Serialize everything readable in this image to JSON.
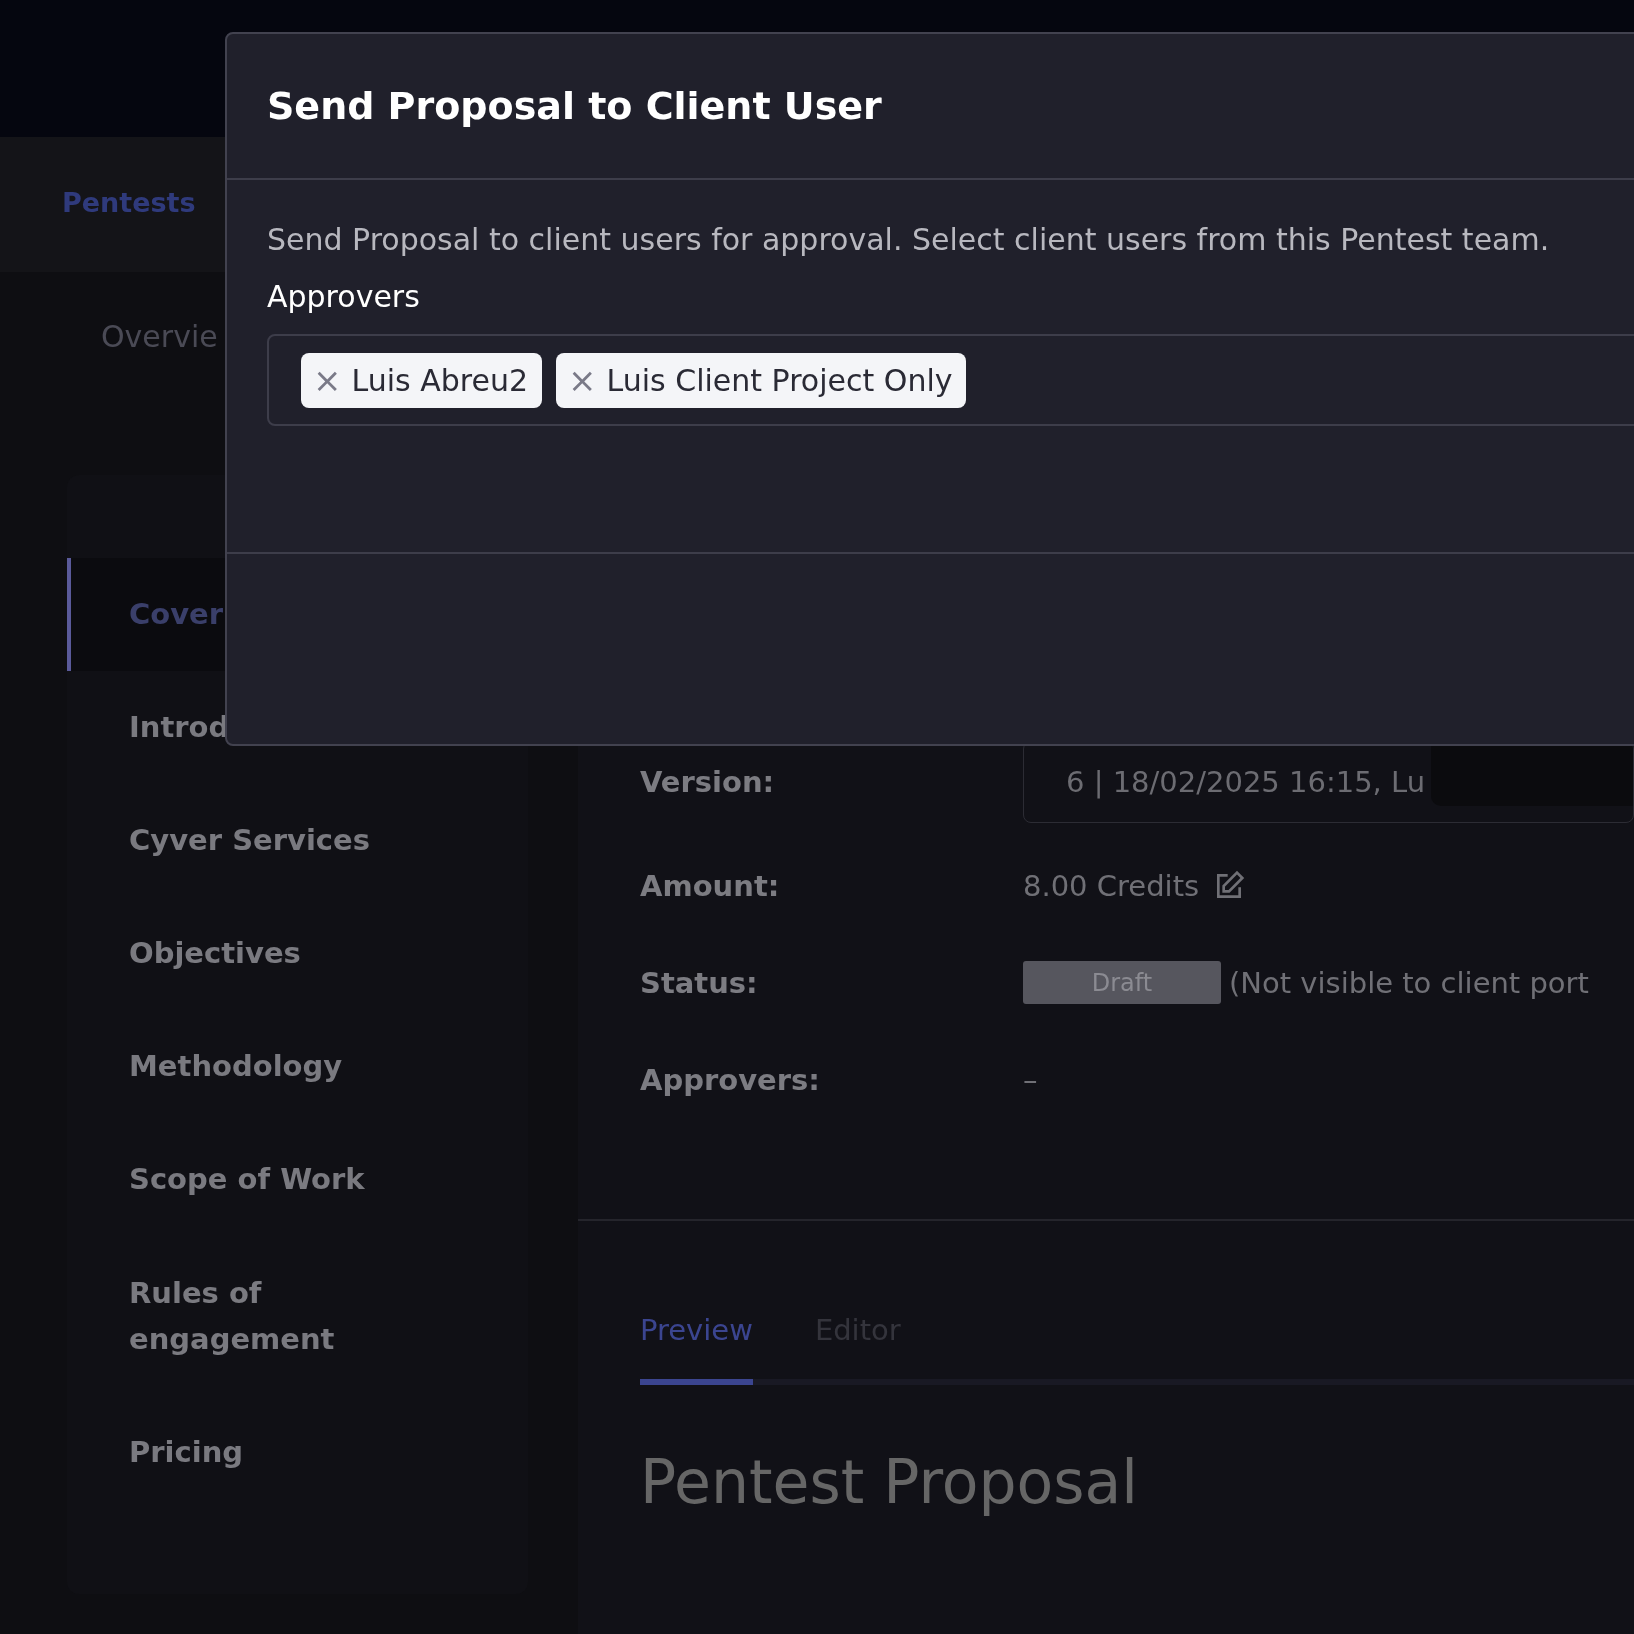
{
  "header": {
    "title": "Pentests"
  },
  "overview_tab": {
    "label": "Overvie"
  },
  "sidebar": {
    "items": [
      {
        "label": "Cover",
        "selected": true
      },
      {
        "label": "Introd",
        "selected": false
      },
      {
        "label": "Cyver Services",
        "selected": false
      },
      {
        "label": "Objectives",
        "selected": false
      },
      {
        "label": "Methodology",
        "selected": false
      },
      {
        "label": "Scope of Work",
        "selected": false
      },
      {
        "label": "Rules of engagement",
        "selected": false
      },
      {
        "label": "Pricing",
        "selected": false
      }
    ]
  },
  "details": [
    {
      "label": "Version:",
      "kind": "field",
      "value": "6 | 18/02/2025 16:15, Lu"
    },
    {
      "label": "Amount:",
      "kind": "editable",
      "value": "8.00 Credits"
    },
    {
      "label": "Status:",
      "kind": "badge",
      "value": "Draft",
      "note": "(Not visible to client port"
    },
    {
      "label": "Approvers:",
      "kind": "text",
      "value": "–"
    }
  ],
  "tabs": [
    {
      "label": "Preview",
      "selected": true
    },
    {
      "label": "Editor",
      "selected": false
    }
  ],
  "document": {
    "heading": "Pentest Proposal"
  },
  "modal": {
    "title": "Send Proposal to Client User",
    "description": "Send Proposal to client users for approval. Select client users from this Pentest team.",
    "field_label": "Approvers",
    "chips": [
      {
        "label": "Luis Abreu2",
        "remove": "×"
      },
      {
        "label": "Luis Client Project Only",
        "remove": "×"
      }
    ]
  }
}
